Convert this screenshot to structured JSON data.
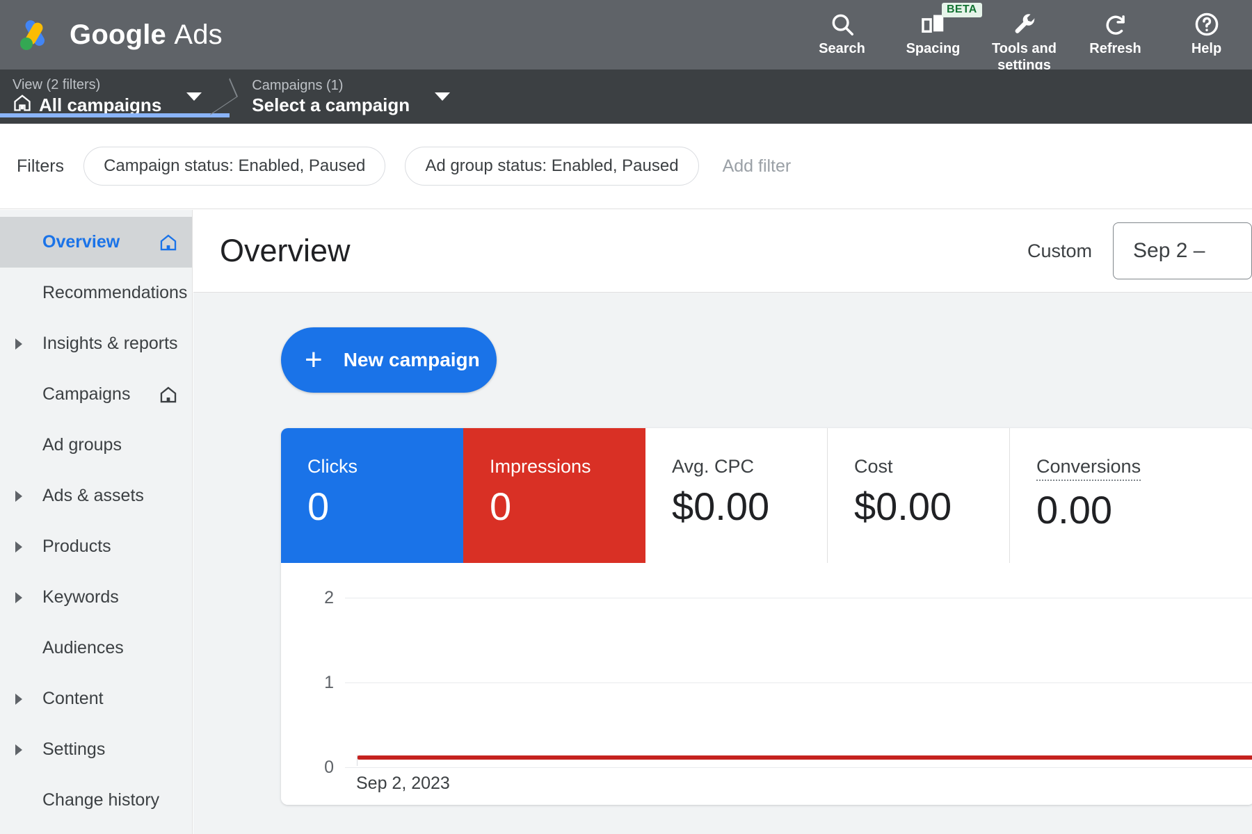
{
  "app": {
    "brand_primary": "Google",
    "brand_secondary": "Ads",
    "header_bg": "#5f6368",
    "accent_blue": "#1a73e8",
    "accent_red": "#d93025"
  },
  "topbar": {
    "actions": [
      {
        "label": "Search",
        "icon": "search-icon",
        "badge": null
      },
      {
        "label": "Spacing",
        "icon": "spacing-icon",
        "badge": "BETA"
      },
      {
        "label": "Tools and settings",
        "icon": "wrench-icon",
        "badge": null
      },
      {
        "label": "Refresh",
        "icon": "refresh-icon",
        "badge": null
      },
      {
        "label": "Help",
        "icon": "help-icon",
        "badge": null
      }
    ]
  },
  "breadcrumb": {
    "items": [
      {
        "top": "View (2 filters)",
        "bottom": "All campaigns",
        "icon": "home-icon",
        "active": true
      },
      {
        "top": "Campaigns (1)",
        "bottom": "Select a campaign",
        "icon": null,
        "active": false
      }
    ]
  },
  "filters": {
    "label": "Filters",
    "chips": [
      "Campaign status: Enabled, Paused",
      "Ad group status: Enabled, Paused"
    ],
    "add_filter": "Add filter"
  },
  "sidebar": {
    "items": [
      {
        "label": "Overview",
        "expandable": false,
        "home": true,
        "active": true
      },
      {
        "label": "Recommendations",
        "expandable": false,
        "home": false,
        "active": false
      },
      {
        "label": "Insights & reports",
        "expandable": true,
        "home": false,
        "active": false
      },
      {
        "label": "Campaigns",
        "expandable": false,
        "home": true,
        "active": false
      },
      {
        "label": "Ad groups",
        "expandable": false,
        "home": false,
        "active": false
      },
      {
        "label": "Ads & assets",
        "expandable": true,
        "home": false,
        "active": false
      },
      {
        "label": "Products",
        "expandable": true,
        "home": false,
        "active": false
      },
      {
        "label": "Keywords",
        "expandable": true,
        "home": false,
        "active": false
      },
      {
        "label": "Audiences",
        "expandable": false,
        "home": false,
        "active": false
      },
      {
        "label": "Content",
        "expandable": true,
        "home": false,
        "active": false
      },
      {
        "label": "Settings",
        "expandable": true,
        "home": false,
        "active": false
      },
      {
        "label": "Change history",
        "expandable": false,
        "home": false,
        "active": false
      }
    ]
  },
  "page": {
    "title": "Overview",
    "date_preset": "Custom",
    "date_range": "Sep 2 –",
    "new_campaign_button": "New campaign",
    "new_campaign_icon": "plus-icon"
  },
  "metrics": [
    {
      "label": "Clicks",
      "value": "0",
      "style": "selected-blue",
      "tooltip": false
    },
    {
      "label": "Impressions",
      "value": "0",
      "style": "selected-red",
      "tooltip": false
    },
    {
      "label": "Avg. CPC",
      "value": "$0.00",
      "style": "plain",
      "tooltip": false
    },
    {
      "label": "Cost",
      "value": "$0.00",
      "style": "plain",
      "tooltip": false
    },
    {
      "label": "Conversions",
      "value": "0.00",
      "style": "plain",
      "tooltip": true
    }
  ],
  "chart_data": {
    "type": "line",
    "title": "",
    "xlabel": "",
    "ylabel": "",
    "x": [
      "Sep 2, 2023"
    ],
    "tick_labels_x": [
      "Sep 2, 2023"
    ],
    "tick_labels_y": [
      "2",
      "1",
      "0"
    ],
    "ylim": [
      0,
      2
    ],
    "grid": true,
    "legend": "none",
    "series": [
      {
        "name": "Impressions",
        "color": "#c5221f",
        "values": [
          0
        ]
      },
      {
        "name": "Clicks",
        "color": "#1a73e8",
        "values": [
          0
        ]
      }
    ]
  }
}
